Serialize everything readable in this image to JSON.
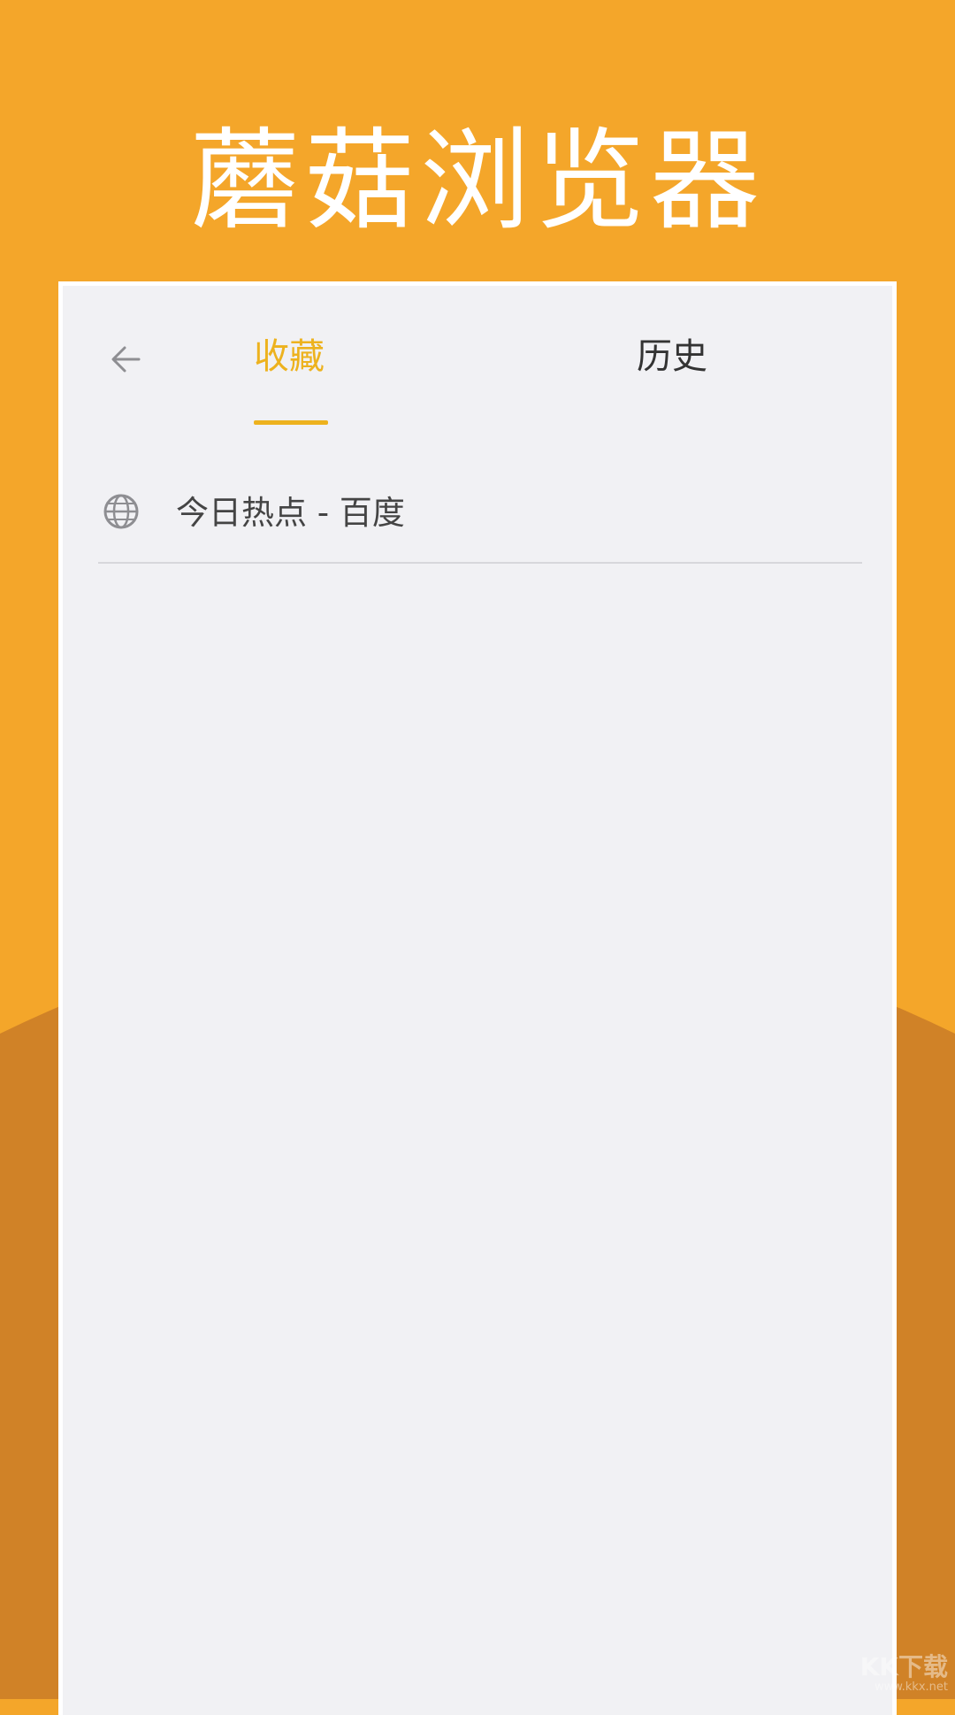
{
  "headline": "蘑菇浏览器",
  "header": {
    "back_icon": "back-arrow-icon",
    "tabs": [
      {
        "label": "收藏",
        "active": true
      },
      {
        "label": "历史",
        "active": false
      }
    ]
  },
  "favorites": [
    {
      "icon": "globe-icon",
      "label": "今日热点 - 百度"
    }
  ],
  "watermark": {
    "main": "KK下载",
    "sub": "www.kkx.net"
  },
  "colors": {
    "background_top": "#F4A62A",
    "background_bottom": "#D08227",
    "accent": "#EDB21E",
    "panel": "#F1F1F4"
  }
}
